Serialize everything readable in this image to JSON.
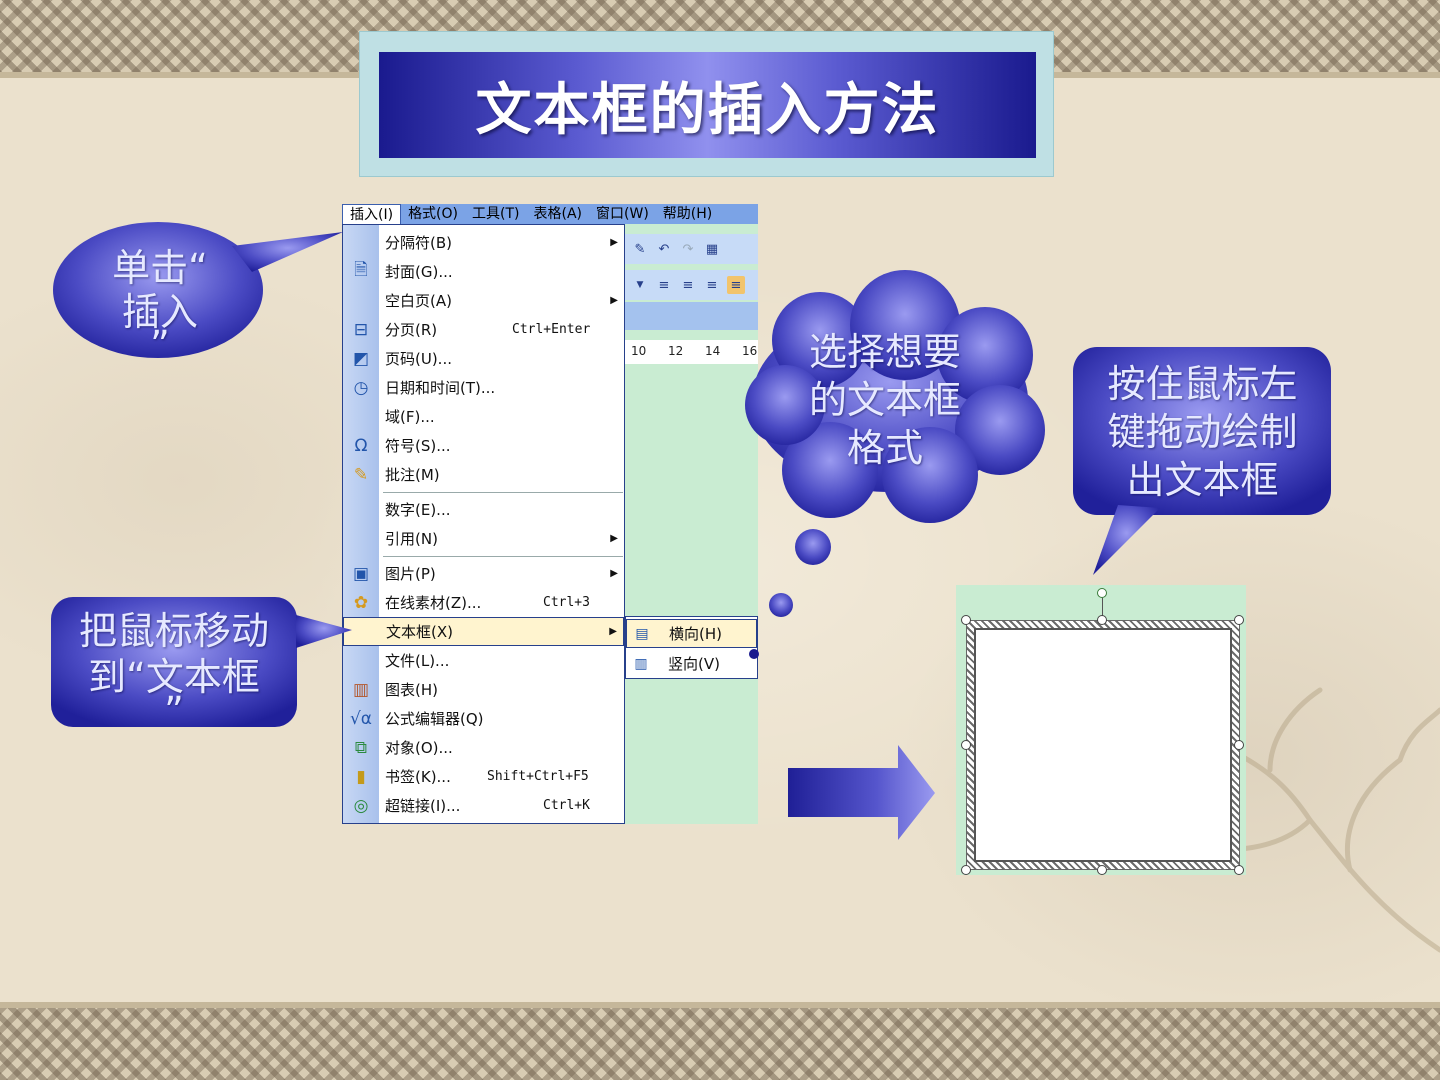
{
  "slide": {
    "title": "文本框的插入方法"
  },
  "callouts": {
    "click_insert": {
      "line1": "单击“",
      "line2": "插入",
      "line3": "”"
    },
    "move_to_textbox": {
      "line1": "把鼠标移动",
      "line2": "到“文本框",
      "line3": "”"
    },
    "choose_format": {
      "line1": "选择想要",
      "line2": "的文本框",
      "line3": "格式"
    },
    "drag_draw": {
      "line1": "按住鼠标左",
      "line2": "键拖动绘制",
      "line3": "出文本框"
    }
  },
  "menubar": {
    "items": [
      "插入(I)",
      "格式(O)",
      "工具(T)",
      "表格(A)",
      "窗口(W)",
      "帮助(H)"
    ]
  },
  "insert_menu": {
    "items": [
      {
        "icon": "",
        "label": "分隔符(B)",
        "shortcut": "",
        "submenu": true
      },
      {
        "icon": "cover-page-icon",
        "label": "封面(G)...",
        "shortcut": "",
        "submenu": false
      },
      {
        "icon": "",
        "label": "空白页(A)",
        "shortcut": "",
        "submenu": true
      },
      {
        "icon": "page-break-icon",
        "label": "分页(R)",
        "shortcut": "Ctrl+Enter",
        "submenu": false
      },
      {
        "icon": "page-number-icon",
        "label": "页码(U)...",
        "shortcut": "",
        "submenu": false
      },
      {
        "icon": "date-time-icon",
        "label": "日期和时间(T)...",
        "shortcut": "",
        "submenu": false
      },
      {
        "icon": "",
        "label": "域(F)...",
        "shortcut": "",
        "submenu": false
      },
      {
        "icon": "omega-icon",
        "label": "符号(S)...",
        "shortcut": "",
        "submenu": false
      },
      {
        "icon": "comment-icon",
        "label": "批注(M)",
        "shortcut": "",
        "submenu": false
      },
      {
        "icon": "",
        "label": "数字(E)...",
        "shortcut": "",
        "submenu": false
      },
      {
        "icon": "",
        "label": "引用(N)",
        "shortcut": "",
        "submenu": true
      },
      {
        "icon": "picture-icon",
        "label": "图片(P)",
        "shortcut": "",
        "submenu": true
      },
      {
        "icon": "clip-art-icon",
        "label": "在线素材(Z)...",
        "shortcut": "Ctrl+3",
        "submenu": false
      },
      {
        "icon": "",
        "label": "文本框(X)",
        "shortcut": "",
        "submenu": true,
        "highlighted": true
      },
      {
        "icon": "",
        "label": "文件(L)...",
        "shortcut": "",
        "submenu": false
      },
      {
        "icon": "chart-icon",
        "label": "图表(H)",
        "shortcut": "",
        "submenu": false
      },
      {
        "icon": "equation-icon",
        "label": "公式编辑器(Q)",
        "shortcut": "",
        "submenu": false
      },
      {
        "icon": "object-icon",
        "label": "对象(O)...",
        "shortcut": "",
        "submenu": false
      },
      {
        "icon": "bookmark-icon",
        "label": "书签(K)...",
        "shortcut": "Shift+Ctrl+F5",
        "submenu": false
      },
      {
        "icon": "hyperlink-icon",
        "label": "超链接(I)...",
        "shortcut": "Ctrl+K",
        "submenu": false
      }
    ]
  },
  "textbox_submenu": {
    "items": [
      {
        "icon": "horizontal-textbox-icon",
        "label": "横向(H)",
        "highlighted": true
      },
      {
        "icon": "vertical-textbox-icon",
        "label": "竖向(V)",
        "highlighted": false
      }
    ]
  },
  "ruler": {
    "ticks": [
      "10",
      "12",
      "14",
      "16"
    ]
  },
  "colors": {
    "callout_dark": "#1f1f96",
    "callout_light": "#8c8ce6",
    "title_bar": "#1a1a8e",
    "menu_highlight": "#fff4cf",
    "document_bg": "#c9ecd2"
  }
}
